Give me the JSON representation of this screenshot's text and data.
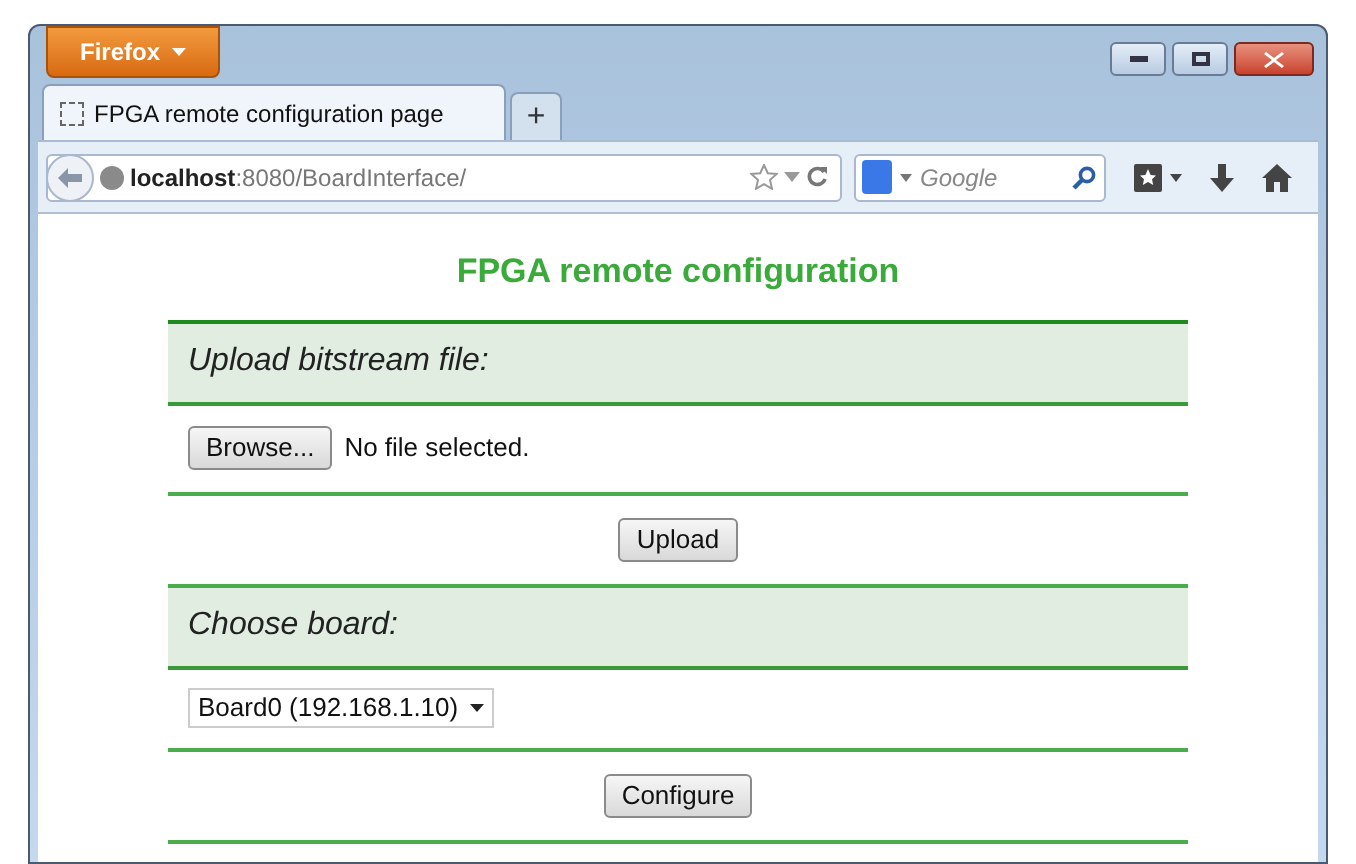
{
  "browser": {
    "app_menu": "Firefox",
    "tabs": [
      {
        "title": "FPGA remote configuration page",
        "selected": true
      }
    ],
    "new_tab": "+",
    "url": {
      "host": "localhost",
      "path": ":8080/BoardInterface/"
    },
    "search": {
      "placeholder": "Google"
    }
  },
  "page": {
    "title": "FPGA remote configuration",
    "sections": [
      {
        "kind": "header",
        "text": "Upload bitstream file:"
      },
      {
        "kind": "file",
        "button": "Browse...",
        "status": "No file selected."
      },
      {
        "kind": "action",
        "button": "Upload"
      },
      {
        "kind": "header",
        "text": "Choose board:"
      },
      {
        "kind": "select",
        "value": "Board0 (192.168.1.10)"
      },
      {
        "kind": "action",
        "button": "Configure"
      }
    ]
  }
}
